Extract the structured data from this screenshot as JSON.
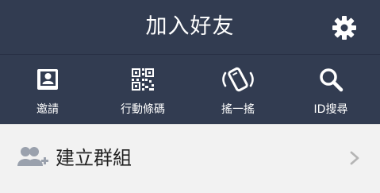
{
  "header": {
    "title": "加入好友",
    "settings_icon": "gear-icon"
  },
  "toolbar": {
    "items": [
      {
        "label": "邀請",
        "icon": "contact-book-icon"
      },
      {
        "label": "行動條碼",
        "icon": "qr-code-icon"
      },
      {
        "label": "搖一搖",
        "icon": "shake-phone-icon"
      },
      {
        "label": "ID搜尋",
        "icon": "search-icon"
      }
    ]
  },
  "list": {
    "items": [
      {
        "label": "建立群組",
        "icon": "add-group-icon",
        "action_icon": "chevron-right-icon"
      }
    ]
  },
  "colors": {
    "header_bg": "#323c51",
    "list_bg": "#f2f2f2",
    "icon_gray": "#9aa1ad"
  }
}
